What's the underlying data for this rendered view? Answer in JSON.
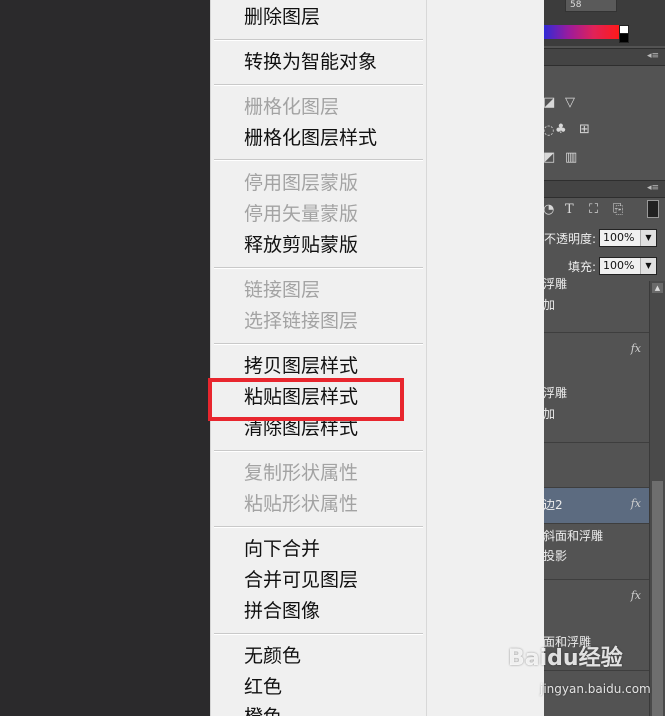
{
  "context_menu": {
    "items": [
      {
        "label": "删除图层",
        "enabled": true
      },
      {
        "label": "转换为智能对象",
        "enabled": true
      },
      {
        "label": "栅格化图层",
        "enabled": false
      },
      {
        "label": "栅格化图层样式",
        "enabled": true
      },
      {
        "label": "停用图层蒙版",
        "enabled": false
      },
      {
        "label": "停用矢量蒙版",
        "enabled": false
      },
      {
        "label": "释放剪贴蒙版",
        "enabled": true
      },
      {
        "label": "链接图层",
        "enabled": false
      },
      {
        "label": "选择链接图层",
        "enabled": false
      },
      {
        "label": "拷贝图层样式",
        "enabled": true
      },
      {
        "label": "粘贴图层样式",
        "enabled": true,
        "highlighted": true
      },
      {
        "label": "清除图层样式",
        "enabled": true
      },
      {
        "label": "复制形状属性",
        "enabled": false
      },
      {
        "label": "粘贴形状属性",
        "enabled": false
      },
      {
        "label": "向下合并",
        "enabled": true
      },
      {
        "label": "合并可见图层",
        "enabled": true
      },
      {
        "label": "拼合图像",
        "enabled": true
      },
      {
        "label": "无颜色",
        "enabled": true
      },
      {
        "label": "红色",
        "enabled": true
      },
      {
        "label": "橙色",
        "enabled": true
      }
    ],
    "highlight_color": "#e8262e"
  },
  "color_panel": {
    "value": "58"
  },
  "layers_panel": {
    "opacity_label": "不透明度:",
    "opacity_value": "100%",
    "fill_label": "填充:",
    "fill_value": "100%",
    "rows": [
      {
        "lines": [
          "浮雕",
          "加"
        ],
        "fx": ""
      },
      {
        "lines": [
          "浮雕",
          "加"
        ],
        "fx": "fx"
      },
      {
        "lines": [
          ""
        ],
        "fx": ""
      },
      {
        "lines": [
          "边2"
        ],
        "fx": "fx",
        "selected": true
      },
      {
        "lines": [
          "斜面和浮雕",
          "投影"
        ],
        "fx": ""
      },
      {
        "lines": [
          "面和浮雕"
        ],
        "fx": "fx"
      }
    ]
  },
  "watermark": {
    "logo": "Baidu经验",
    "url": "jingyan.baidu.com"
  }
}
